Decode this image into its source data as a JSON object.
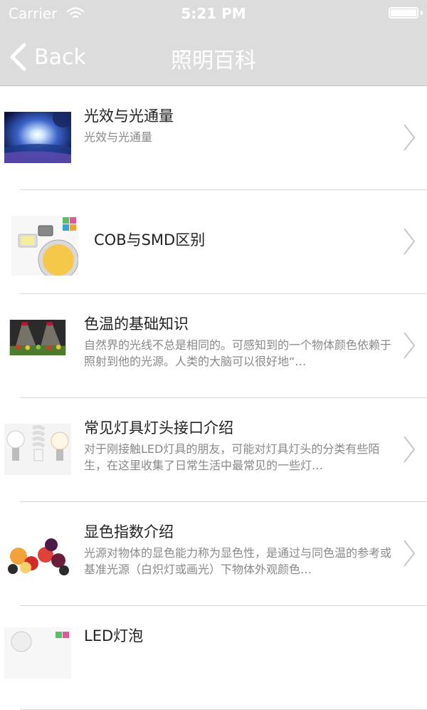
{
  "status": {
    "carrier": "Carrier",
    "time": "5:21 PM"
  },
  "nav": {
    "back_label": "Back",
    "title": "照明百科"
  },
  "items": [
    {
      "title": "光效与光通量",
      "subtitle": "光效与光通量"
    },
    {
      "title": "COB与SMD区别",
      "subtitle": ""
    },
    {
      "title": "色温的基础知识",
      "subtitle": "自然界的光线不总是相同的。可感知到的一个物体颜色依赖于照射到他的光源。人类的大脑可以很好地“…"
    },
    {
      "title": "常见灯具灯头接口介绍",
      "subtitle": "对于刚接触LED灯具的朋友，可能对灯具灯头的分类有些陌生，在这里收集了日常生活中最常见的一些灯…"
    },
    {
      "title": "显色指数介绍",
      "subtitle": "光源对物体的显色能力称为显色性，是通过与同色温的参考或基准光源（白炽灯或画光）下物体外观颜色…"
    },
    {
      "title": "LED灯泡",
      "subtitle": ""
    }
  ]
}
